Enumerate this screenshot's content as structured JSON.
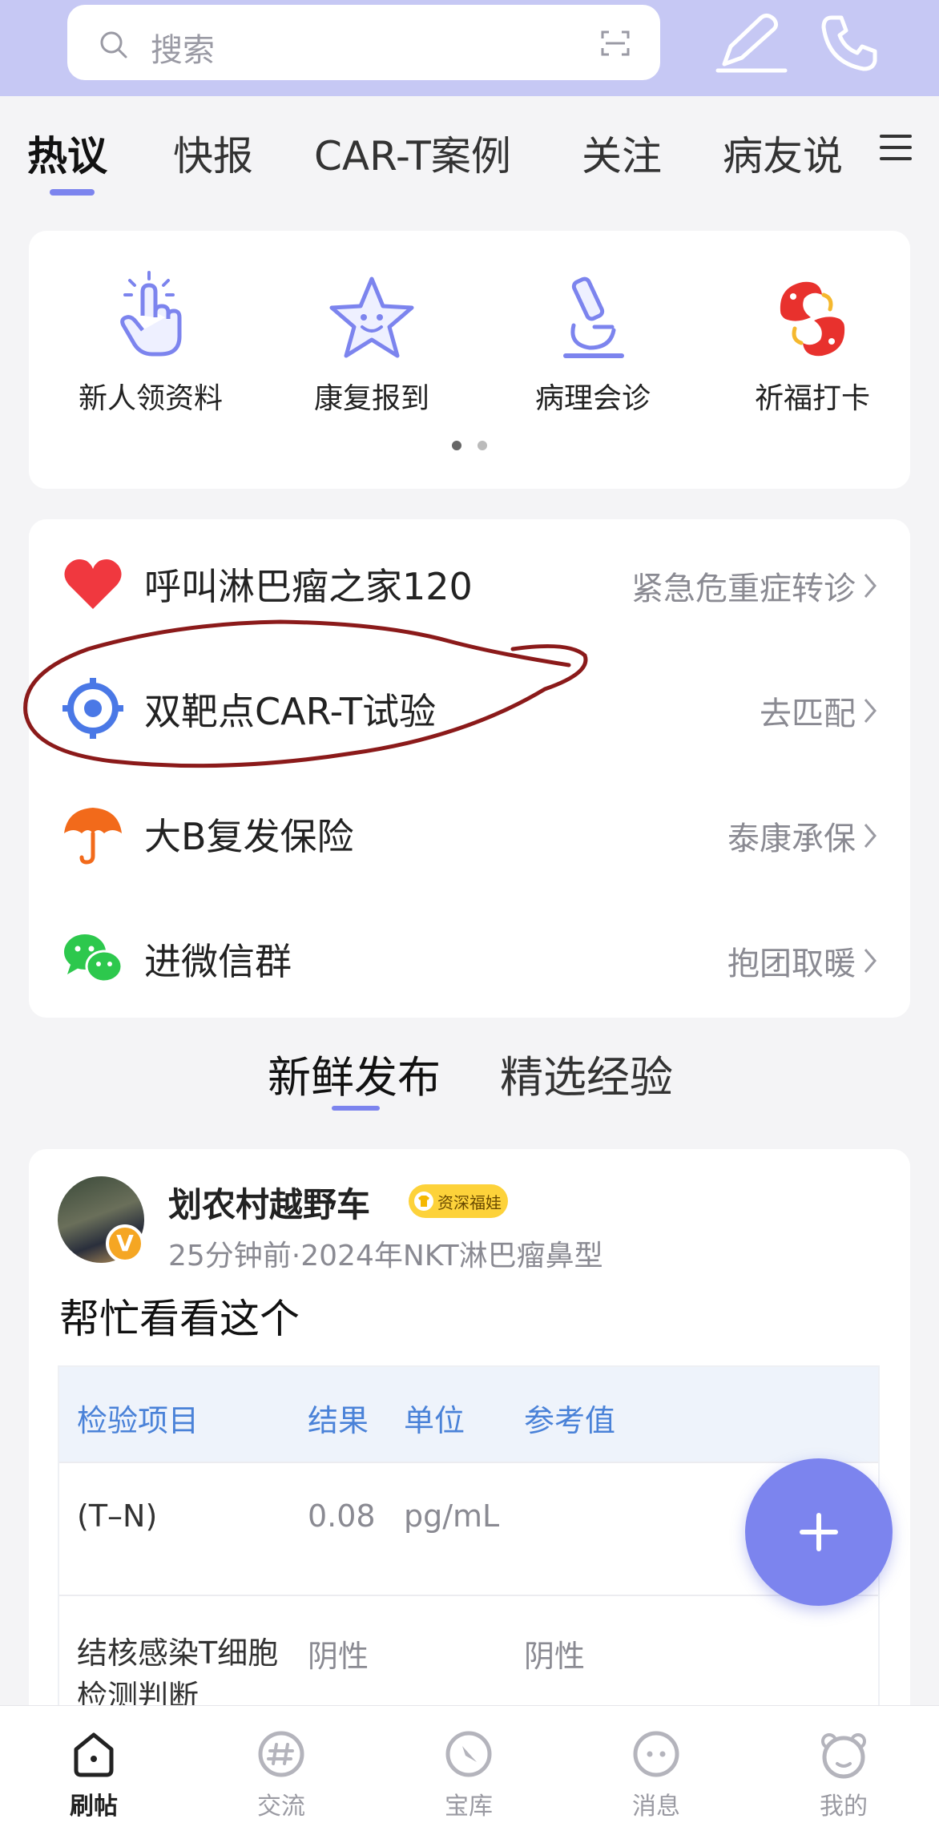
{
  "search": {
    "placeholder": "搜索"
  },
  "tabs": [
    {
      "label": "热议"
    },
    {
      "label": "快报"
    },
    {
      "label": "CAR-T案例"
    },
    {
      "label": "关注"
    },
    {
      "label": "病友说"
    }
  ],
  "quick_actions": [
    {
      "label": "新人领资料",
      "icon": "tap-hand-icon"
    },
    {
      "label": "康复报到",
      "icon": "star-face-icon"
    },
    {
      "label": "病理会诊",
      "icon": "microscope-icon"
    },
    {
      "label": "祈福打卡",
      "icon": "koi-fish-icon"
    }
  ],
  "services": [
    {
      "title": "呼叫淋巴瘤之家120",
      "right": "紧急危重症转诊",
      "icon": "heart-icon"
    },
    {
      "title": "双靶点CAR-T试验",
      "right": "去匹配",
      "icon": "target-icon"
    },
    {
      "title": "大B复发保险",
      "right": "泰康承保",
      "icon": "umbrella-icon"
    },
    {
      "title": "进微信群",
      "right": "抱团取暖",
      "icon": "wechat-icon"
    }
  ],
  "feed_tabs": [
    {
      "label": "新鲜发布"
    },
    {
      "label": "精选经验"
    }
  ],
  "post": {
    "author": "划农村越野车",
    "tag": "资深福娃",
    "meta": "25分钟前·2024年NKT淋巴瘤鼻型",
    "text": "帮忙看看这个",
    "table": {
      "headers": [
        "检验项目",
        "结果",
        "单位",
        "参考值"
      ],
      "rows": [
        [
          "(T–N)",
          "0.08",
          "pg/mL",
          ""
        ],
        [
          "结核感染T细胞检测判断",
          "阴性",
          "",
          "阴性"
        ]
      ]
    }
  },
  "bottom_nav": [
    {
      "label": "刷帖"
    },
    {
      "label": "交流"
    },
    {
      "label": "宝库"
    },
    {
      "label": "消息"
    },
    {
      "label": "我的"
    }
  ],
  "colors": {
    "accent": "#7c84ee",
    "topbar": "#c6c8f4",
    "table_header_text": "#4a82d8"
  }
}
